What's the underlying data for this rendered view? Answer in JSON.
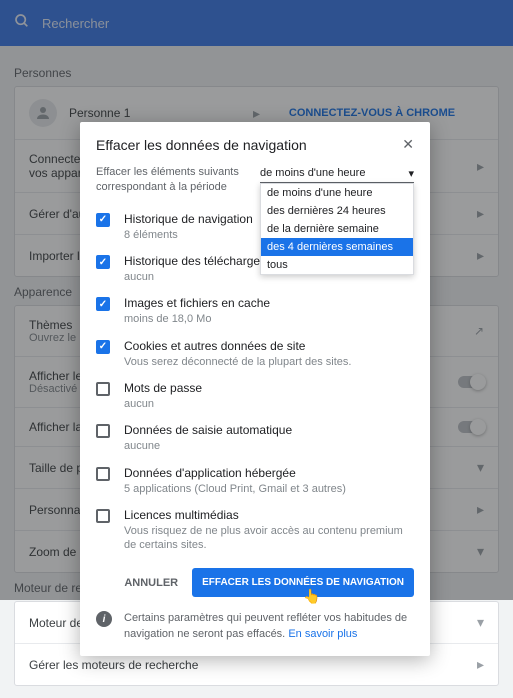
{
  "search": {
    "placeholder": "Rechercher"
  },
  "sections": {
    "personnes": "Personnes",
    "apparence": "Apparence",
    "recherche": "Moteur de rech"
  },
  "bg": {
    "person": "Personne 1",
    "connect": "CONNECTEZ-VOUS À CHROME",
    "sync": "Connectez-vous pour synchroniser et personnaliser Chrome sur tous\nvos apparei",
    "gerer_aut": "Gérer d'aut",
    "importer": "Importer le",
    "themes": "Thèmes",
    "themes_sub": "Ouvrez le D",
    "afficher1": "Afficher le",
    "afficher1_sub": "Désactivé",
    "afficher2": "Afficher la",
    "taille": "Taille de po",
    "personnaliser": "Personnalis",
    "zoom": "Zoom de la",
    "moteur_de": "Moteur de",
    "gerer_moteurs": "Gérer les moteurs de recherche"
  },
  "dialog": {
    "title": "Effacer les données de navigation",
    "period_label": "Effacer les éléments suivants correspondant à la période",
    "period_value": "de moins d'une heure",
    "options": [
      "de moins d'une heure",
      "des dernières 24 heures",
      "de la dernière semaine",
      "des 4 dernières semaines",
      "tous"
    ],
    "items": [
      {
        "checked": true,
        "title": "Historique de navigation",
        "sub": "8 éléments"
      },
      {
        "checked": true,
        "title": "Historique des téléchargements",
        "sub": "aucun"
      },
      {
        "checked": true,
        "title": "Images et fichiers en cache",
        "sub": "moins de 18,0 Mo"
      },
      {
        "checked": true,
        "title": "Cookies et autres données de site",
        "sub": "Vous serez déconnecté de la plupart des sites."
      },
      {
        "checked": false,
        "title": "Mots de passe",
        "sub": "aucun"
      },
      {
        "checked": false,
        "title": "Données de saisie automatique",
        "sub": "aucune"
      },
      {
        "checked": false,
        "title": "Données d'application hébergée",
        "sub": "5 applications (Cloud Print, Gmail et 3 autres)"
      },
      {
        "checked": false,
        "title": "Licences multimédias",
        "sub": "Vous risquez de ne plus avoir accès au contenu premium de certains sites."
      }
    ],
    "cancel": "ANNULER",
    "confirm": "EFFACER LES DONNÉES DE NAVIGATION",
    "info": "Certains paramètres qui peuvent refléter vos habitudes de navigation ne seront pas effacés.",
    "info_link": "En savoir plus"
  }
}
